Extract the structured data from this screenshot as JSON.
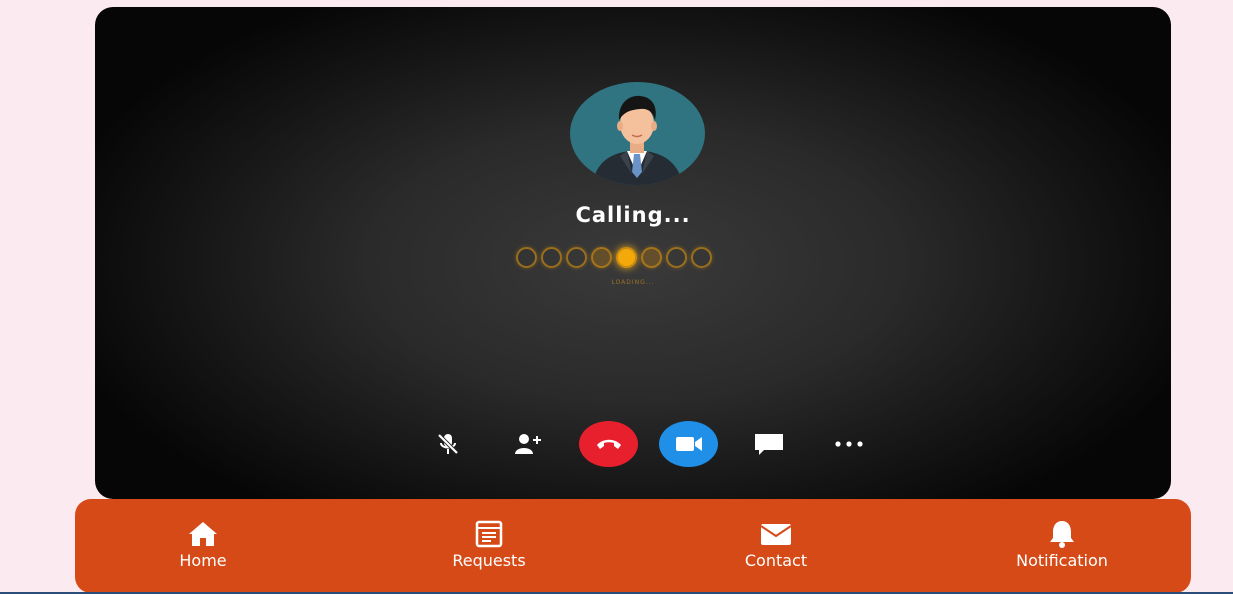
{
  "call": {
    "status_text": "Calling...",
    "loading_text": "LOADING...",
    "loader": {
      "dot_count": 8,
      "active_index": 4
    }
  },
  "controls": [
    {
      "name": "mute-button",
      "icon": "mic-off-icon"
    },
    {
      "name": "add-participant-button",
      "icon": "add-user-icon"
    },
    {
      "name": "end-call-button",
      "icon": "phone-hangup-icon",
      "color": "#e8202d"
    },
    {
      "name": "video-button",
      "icon": "video-camera-icon",
      "color": "#1f8fe8"
    },
    {
      "name": "chat-button",
      "icon": "chat-bubble-icon"
    },
    {
      "name": "more-options-button",
      "icon": "more-horizontal-icon"
    }
  ],
  "nav": {
    "items": [
      {
        "label": "Home",
        "icon": "home-icon"
      },
      {
        "label": "Requests",
        "icon": "requests-icon"
      },
      {
        "label": "Contact",
        "icon": "envelope-icon"
      },
      {
        "label": "Notification",
        "icon": "bell-icon"
      }
    ]
  },
  "colors": {
    "page_background": "#fbeaf0",
    "nav_bar": "#d64a17",
    "hangup": "#e8202d",
    "video": "#1f8fe8",
    "loader_active": "#f4a90a"
  }
}
